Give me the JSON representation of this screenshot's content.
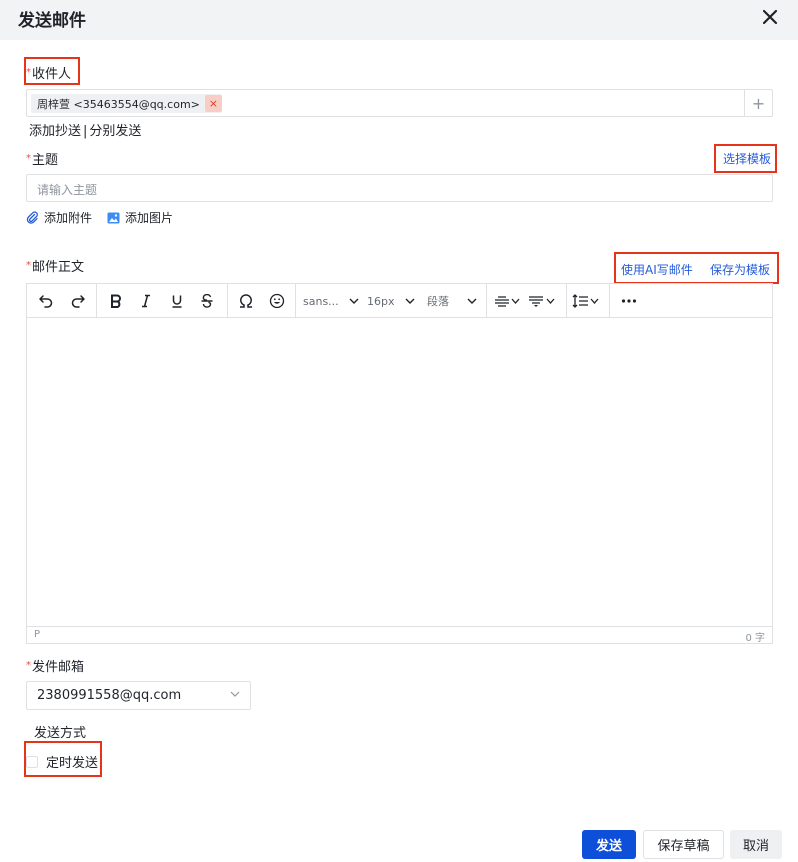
{
  "header": {
    "title": "发送邮件",
    "close_icon": "close-icon"
  },
  "recipient": {
    "label": "收件人",
    "tag_text": "周梓萱 <35463554@qq.com>",
    "tag_close": "×",
    "add_symbol": "+",
    "cc_link": "添加抄送",
    "separator": "|",
    "separate_link": "分别发送"
  },
  "subject": {
    "label": "主题",
    "select_template": "选择模板",
    "placeholder": "请输入主题",
    "add_attachment": "添加附件",
    "add_image": "添加图片"
  },
  "body": {
    "label": "邮件正文",
    "ai_write": "使用AI写邮件",
    "save_template": "保存为模板",
    "toolbar": {
      "font_family": "sans...",
      "font_size": "16px",
      "block_format": "段落"
    },
    "status_path": "P",
    "word_count": "0 字"
  },
  "sender": {
    "label": "发件邮箱",
    "value": "2380991558@qq.com"
  },
  "send_method": {
    "label": "发送方式",
    "scheduled": "定时发送"
  },
  "footer": {
    "send": "发送",
    "save_draft": "保存草稿",
    "cancel": "取消"
  },
  "colors": {
    "accent": "#0d4fd9",
    "link": "#245bdb",
    "required": "#f54a45",
    "highlight_box": "#e8331b"
  }
}
